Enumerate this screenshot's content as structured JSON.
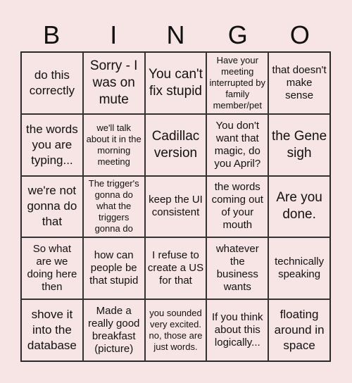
{
  "header": [
    "B",
    "I",
    "N",
    "G",
    "O"
  ],
  "colors": {
    "background": "#f7e4e4",
    "border": "#333333",
    "text": "#111111"
  },
  "cells": [
    "do this correctly",
    "Sorry - I was on mute",
    "You can't fix stupid",
    "Have your meeting interrupted by family member/pet",
    "that doesn't make sense",
    "the words you are typing...",
    "we'll talk about it in the morning meeting",
    "Cadillac version",
    "You don't want that magic, do you April?",
    "the Gene sigh",
    "we're not gonna do that",
    "The trigger's gonna do what the triggers gonna do",
    "keep the UI consistent",
    "the words coming out of your mouth",
    "Are you done.",
    "So what are we doing here then",
    "how can people be that stupid",
    "I refuse to create a US for that",
    "whatever the business wants",
    "technically speaking",
    "shove it into the database",
    "Made a really good breakfast (picture)",
    "you sounded very excited. no, those are just words.",
    "If you think about this logically...",
    "floating around in space"
  ]
}
